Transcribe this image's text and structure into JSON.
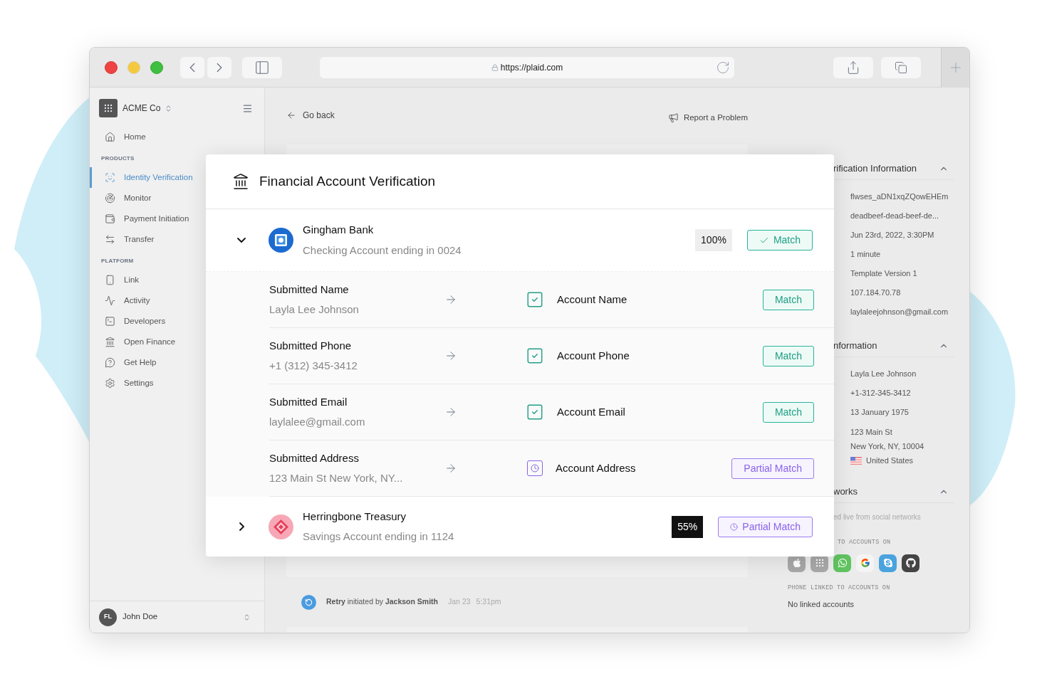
{
  "browser": {
    "url": "https://plaid.com"
  },
  "sidebar": {
    "org": "ACME Co",
    "sections": [
      {
        "items": [
          {
            "label": "Home",
            "selected": false
          }
        ]
      },
      {
        "heading": "PRODUCTS",
        "items": [
          {
            "label": "Identity Verification",
            "selected": true
          },
          {
            "label": "Monitor",
            "selected": false
          },
          {
            "label": "Payment Initiation",
            "selected": false
          },
          {
            "label": "Transfer",
            "selected": false
          }
        ]
      },
      {
        "heading": "PLATFORM",
        "items": [
          {
            "label": "Link",
            "selected": false
          },
          {
            "label": "Activity",
            "selected": false
          },
          {
            "label": "Developers",
            "selected": false
          },
          {
            "label": "Open Finance",
            "selected": false
          },
          {
            "label": "Get Help",
            "selected": false
          },
          {
            "label": "Settings",
            "selected": false
          }
        ]
      }
    ],
    "user": {
      "initials": "FL",
      "name": "John Doe"
    }
  },
  "page": {
    "back": "Go back",
    "report": "Report a Problem",
    "retry": {
      "text": "**Retry** initiated by **Jackson Smith**",
      "date": "Jan 23",
      "time": "5:31pm"
    }
  },
  "details": {
    "sections": [
      {
        "title": "rification Information",
        "expanded": true,
        "rows": [
          "flwses_aDN1xqZQowEHEm",
          "deadbeef-dead-beef-de...",
          "Jun 23rd, 2022, 3:30PM",
          "1 minute",
          "Template Version 1",
          "107.184.70.78",
          "laylaleejohnson@gmail.com"
        ]
      },
      {
        "title": "nformation",
        "expanded": true,
        "rows": [
          "Layla Lee Johnson",
          "+1-312-345-3412",
          "13 January 1975"
        ],
        "address": {
          "lines": [
            "123 Main St",
            "New York, NY, 10004"
          ],
          "country": "United States"
        }
      },
      {
        "title": "works",
        "expanded": true,
        "note": "ed live from social networks",
        "groups": [
          {
            "heading": "TO ACCOUNTS ON",
            "accounts": [
              {
                "linked": false
              },
              {
                "linked": false
              },
              {
                "linked": true
              },
              {
                "linked": true
              },
              {
                "linked": true
              },
              {
                "linked": true
              }
            ]
          },
          {
            "heading": "PHONE LINKED TO ACCOUNTS ON",
            "empty": "No linked accounts"
          }
        ]
      }
    ]
  },
  "modal": {
    "title": "Financial Account Verification",
    "accounts": [
      {
        "kind": "square",
        "name": "Gingham Bank",
        "detail": "Checking Account ending in 0024",
        "expanded": true,
        "score": "100%",
        "status": {
          "label": "Match",
          "kind": "match"
        },
        "fields": [
          {
            "submitted_label": "Submitted Name",
            "submitted_value": "Layla Lee Johnson",
            "account_label": "Account Name",
            "status": {
              "label": "Match",
              "kind": "match"
            }
          },
          {
            "submitted_label": "Submitted Phone",
            "submitted_value": "+1 (312) 345-3412",
            "account_label": "Account Phone",
            "status": {
              "label": "Match",
              "kind": "match"
            }
          },
          {
            "submitted_label": "Submitted Email",
            "submitted_value": "laylalee@gmail.com",
            "account_label": "Account Email",
            "status": {
              "label": "Match",
              "kind": "match"
            }
          },
          {
            "submitted_label": "Submitted Address",
            "submitted_value": "123 Main St New York, NY...",
            "account_label": "Account Address",
            "status": {
              "label": "Partial Match",
              "kind": "partial"
            }
          }
        ]
      },
      {
        "kind": "diamond",
        "name": "Herringbone Treasury",
        "detail": "Savings Account ending in 1124",
        "expanded": false,
        "score": "55%",
        "status": {
          "label": "Partial Match",
          "kind": "partial"
        }
      }
    ]
  }
}
